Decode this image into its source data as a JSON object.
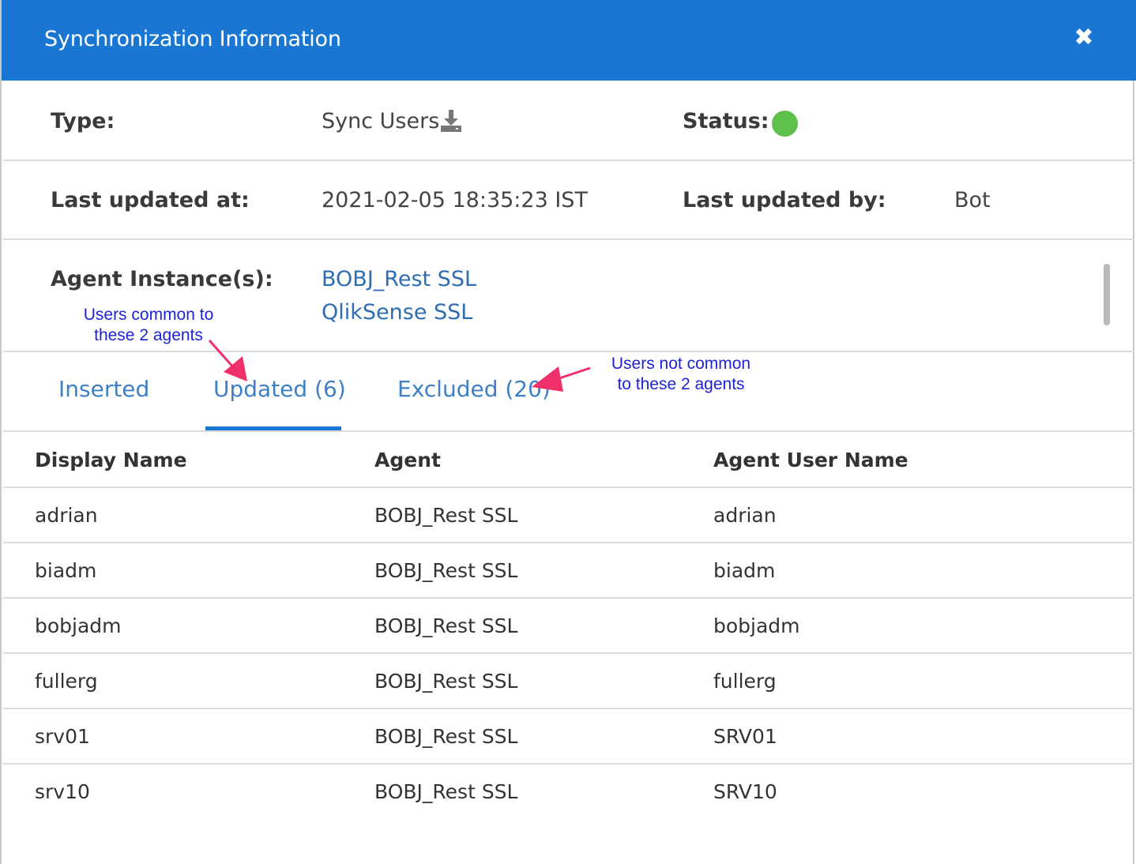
{
  "dialog": {
    "title": "Synchronization Information",
    "close_icon": "close-icon"
  },
  "info": {
    "type_label": "Type:",
    "type_value": "Sync Users",
    "type_icon": "download-icon",
    "status_label": "Status:",
    "status_color": "#5cc04a",
    "last_updated_at_label": "Last updated at:",
    "last_updated_at_value": "2021-02-05 18:35:23 IST",
    "last_updated_by_label": "Last updated by:",
    "last_updated_by_value": "Bot",
    "agent_instances_label": "Agent Instance(s):",
    "agent_instances": [
      "BOBJ_Rest SSL",
      "QlikSense SSL"
    ]
  },
  "tabs": [
    {
      "label": "Inserted",
      "active": false
    },
    {
      "label": "Updated (6)",
      "active": true
    },
    {
      "label": "Excluded (20)",
      "active": false
    }
  ],
  "annotations": {
    "common_line1": "Users common to",
    "common_line2": "these 2 agents",
    "not_common_line1": "Users not common",
    "not_common_line2": "to these 2 agents",
    "arrow_color": "#f0306a"
  },
  "table": {
    "columns": [
      "Display Name",
      "Agent",
      "Agent User Name"
    ],
    "rows": [
      [
        "adrian",
        "BOBJ_Rest SSL",
        "adrian"
      ],
      [
        "biadm",
        "BOBJ_Rest SSL",
        "biadm"
      ],
      [
        "bobjadm",
        "BOBJ_Rest SSL",
        "bobjadm"
      ],
      [
        "fullerg",
        "BOBJ_Rest SSL",
        "fullerg"
      ],
      [
        "srv01",
        "BOBJ_Rest SSL",
        "SRV01"
      ],
      [
        "srv10",
        "BOBJ_Rest SSL",
        "SRV10"
      ]
    ]
  },
  "colors": {
    "header_bg": "#1976d2",
    "link": "#2f6db3",
    "tab_active_underline": "#1976d2",
    "annotation_text": "#1f23d6"
  }
}
